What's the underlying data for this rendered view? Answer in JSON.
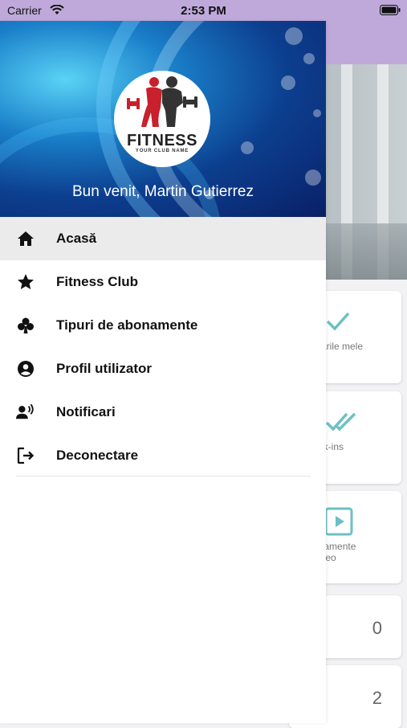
{
  "status_bar": {
    "carrier": "Carrier",
    "time": "2:53 PM"
  },
  "drawer": {
    "logo_title": "FITNESS",
    "logo_subtitle": "YOUR CLUB NAME",
    "welcome": "Bun venit, Martin Gutierrez",
    "items": [
      {
        "label": "Acasă",
        "icon": "home-icon",
        "active": true
      },
      {
        "label": "Fitness Club",
        "icon": "star-icon"
      },
      {
        "label": "Tipuri de abonamente",
        "icon": "club-icon"
      },
      {
        "label": "Profil utilizator",
        "icon": "account-circle-icon"
      },
      {
        "label": "Notificari",
        "icon": "record-voice-icon"
      },
      {
        "label": "Deconectare",
        "icon": "logout-icon"
      }
    ]
  },
  "background": {
    "cards": [
      {
        "label_line1": "marile mele",
        "label_line2": ""
      },
      {
        "label_line1": "eck-ins",
        "label_line2": ""
      },
      {
        "label_line1": "enamente",
        "label_line2": "video"
      },
      {
        "number": "0"
      },
      {
        "number": "2"
      }
    ],
    "accent_color": "#6cc0c4",
    "header_color": "#bfa9da"
  }
}
